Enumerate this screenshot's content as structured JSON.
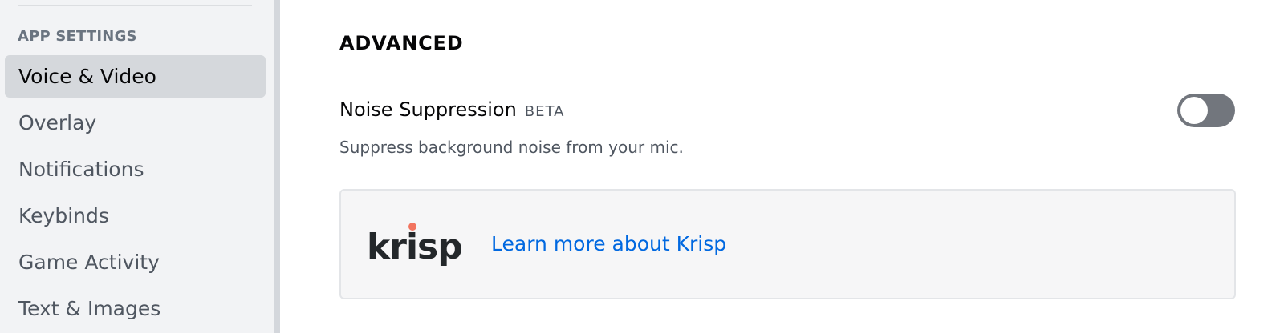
{
  "sidebar": {
    "header": "APP SETTINGS",
    "items": [
      {
        "label": "Voice & Video",
        "selected": true
      },
      {
        "label": "Overlay",
        "selected": false
      },
      {
        "label": "Notifications",
        "selected": false
      },
      {
        "label": "Keybinds",
        "selected": false
      },
      {
        "label": "Game Activity",
        "selected": false
      },
      {
        "label": "Text & Images",
        "selected": false
      }
    ]
  },
  "main": {
    "section_title": "ADVANCED",
    "noise_suppression": {
      "title": "Noise Suppression",
      "badge": "BETA",
      "description": "Suppress background noise from your mic.",
      "enabled": false
    },
    "krisp": {
      "logo_text": "krisp",
      "link_label": "Learn more about Krisp"
    }
  },
  "colors": {
    "sidebar_bg": "#f2f3f5",
    "selected_item_bg": "#d5d8dc",
    "toggle_off": "#72767d",
    "link": "#0068e0",
    "krisp_dot": "#f2745f"
  }
}
